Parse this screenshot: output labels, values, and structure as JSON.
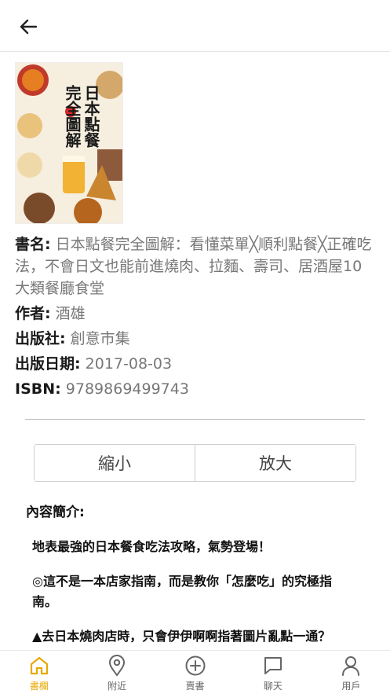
{
  "header": {
    "back_icon": "arrow-left-icon"
  },
  "book": {
    "cover_title_lines": [
      "日本點餐",
      "完全圖解"
    ],
    "title_label": "書名:",
    "title_value": "日本點餐完全圖解：看懂菜單╳順利點餐╳正確吃法，不會日文也能前進燒肉、拉麵、壽司、居酒屋10大類餐廳食堂",
    "author_label": "作者:",
    "author_value": "酒雄",
    "publisher_label": "出版社:",
    "publisher_value": "創意市集",
    "date_label": "出版日期:",
    "date_value": "2017-08-03",
    "isbn_label": "ISBN:",
    "isbn_value": "9789869499743"
  },
  "zoom": {
    "shrink_label": "縮小",
    "enlarge_label": "放大"
  },
  "description": {
    "title": "內容簡介:",
    "p1": "地表最強的日本餐食吃法攻略，氣勢登場！",
    "p2": "◎這不是一本店家指南，而是教你「怎麼吃」的究極指南。",
    "p3": "▲去日本燒肉店時，只會伊伊啊啊指著圖片亂點一通？"
  },
  "nav": {
    "items": [
      {
        "label": "書欄",
        "icon": "home-icon",
        "active": true
      },
      {
        "label": "附近",
        "icon": "location-pin-icon",
        "active": false
      },
      {
        "label": "賣書",
        "icon": "plus-circle-icon",
        "active": false
      },
      {
        "label": "聊天",
        "icon": "chat-bubble-icon",
        "active": false
      },
      {
        "label": "用戶",
        "icon": "user-icon",
        "active": false
      }
    ]
  },
  "colors": {
    "accent": "#e8a800",
    "divider": "#bdbdbd",
    "muted_text": "#777777"
  }
}
